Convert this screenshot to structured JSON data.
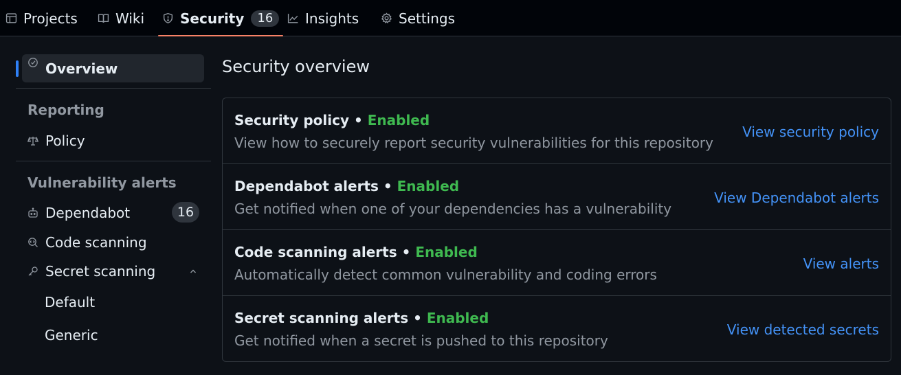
{
  "nav": {
    "tabs": [
      {
        "label": "Projects",
        "icon": "table-icon"
      },
      {
        "label": "Wiki",
        "icon": "book-icon"
      },
      {
        "label": "Security",
        "icon": "shield-icon",
        "counter": "16",
        "active": true
      },
      {
        "label": "Insights",
        "icon": "graph-icon"
      },
      {
        "label": "Settings",
        "icon": "gear-icon"
      }
    ]
  },
  "sidebar": {
    "overview_label": "Overview",
    "reporting_heading": "Reporting",
    "policy_label": "Policy",
    "vuln_heading": "Vulnerability alerts",
    "dependabot_label": "Dependabot",
    "dependabot_count": "16",
    "code_scanning_label": "Code scanning",
    "secret_scanning_label": "Secret scanning",
    "secret_sub": [
      "Default",
      "Generic"
    ]
  },
  "main": {
    "title": "Security overview",
    "rows": [
      {
        "title": "Security policy",
        "status": "Enabled",
        "description": "View how to securely report security vulnerabilities for this repository",
        "link": "View security policy"
      },
      {
        "title": "Dependabot alerts",
        "status": "Enabled",
        "description": "Get notified when one of your dependencies has a vulnerability",
        "link": "View Dependabot alerts"
      },
      {
        "title": "Code scanning alerts",
        "status": "Enabled",
        "description": "Automatically detect common vulnerability and coding errors",
        "link": "View alerts"
      },
      {
        "title": "Secret scanning alerts",
        "status": "Enabled",
        "description": "Get notified when a secret is pushed to this repository",
        "link": "View detected secrets"
      }
    ]
  },
  "colors": {
    "background": "#0d1117",
    "accent_link": "#4493f8",
    "enabled_green": "#3fb950",
    "active_tab_underline": "#f78166",
    "sidebar_active_bar": "#2f81f7"
  }
}
